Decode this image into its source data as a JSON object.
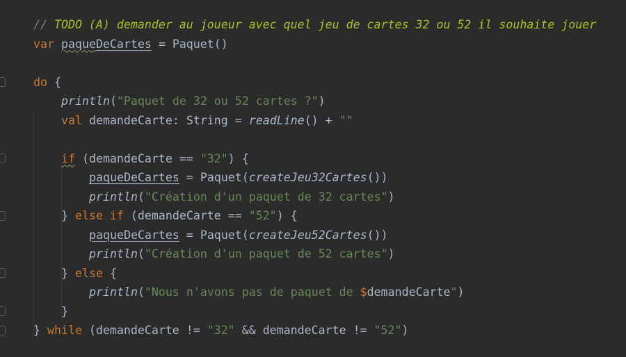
{
  "editor": {
    "lines": [
      {
        "indent": 0,
        "tokens": [
          {
            "t": "// ",
            "c": "cm"
          },
          {
            "t": "TODO (A) demander au joueur avec quel jeu de cartes 32 ou 52 il souhaite jouer",
            "c": "todo"
          }
        ]
      },
      {
        "indent": 0,
        "tokens": [
          {
            "t": "var ",
            "c": "kw"
          },
          {
            "t": "paque",
            "c": "prop warn"
          },
          {
            "t": "DeCartes",
            "c": "prop"
          },
          {
            "t": " = Paquet()",
            "c": ""
          }
        ]
      },
      {
        "indent": 0,
        "tokens": []
      },
      {
        "indent": 0,
        "tokens": [
          {
            "t": "do",
            "c": "kw"
          },
          {
            "t": " {",
            "c": ""
          }
        ]
      },
      {
        "indent": 1,
        "tokens": [
          {
            "t": "println",
            "c": "fn"
          },
          {
            "t": "(",
            "c": ""
          },
          {
            "t": "\"Paquet de 32 ou 52 cartes ?\"",
            "c": "str"
          },
          {
            "t": ")",
            "c": ""
          }
        ]
      },
      {
        "indent": 1,
        "tokens": [
          {
            "t": "val ",
            "c": "kw"
          },
          {
            "t": "demandeCarte: String = ",
            "c": ""
          },
          {
            "t": "readLine",
            "c": "fn"
          },
          {
            "t": "() + ",
            "c": ""
          },
          {
            "t": "\"\"",
            "c": "str"
          }
        ]
      },
      {
        "indent": 0,
        "tokens": []
      },
      {
        "indent": 1,
        "tokens": [
          {
            "t": "if",
            "c": "kw warn"
          },
          {
            "t": " (demandeCarte == ",
            "c": ""
          },
          {
            "t": "\"32\"",
            "c": "str"
          },
          {
            "t": ") {",
            "c": ""
          }
        ]
      },
      {
        "indent": 2,
        "tokens": [
          {
            "t": "paqueDeCartes",
            "c": "prop"
          },
          {
            "t": " = Paquet(",
            "c": ""
          },
          {
            "t": "createJeu32Cartes",
            "c": "fn"
          },
          {
            "t": "())",
            "c": ""
          }
        ]
      },
      {
        "indent": 2,
        "tokens": [
          {
            "t": "println",
            "c": "fn"
          },
          {
            "t": "(",
            "c": ""
          },
          {
            "t": "\"Création d'un paquet de 32 cartes\"",
            "c": "str"
          },
          {
            "t": ")",
            "c": ""
          }
        ]
      },
      {
        "indent": 1,
        "tokens": [
          {
            "t": "} ",
            "c": ""
          },
          {
            "t": "else if",
            "c": "kw"
          },
          {
            "t": " (demandeCarte == ",
            "c": ""
          },
          {
            "t": "\"52\"",
            "c": "str"
          },
          {
            "t": ") {",
            "c": ""
          }
        ]
      },
      {
        "indent": 2,
        "tokens": [
          {
            "t": "paqueDeCartes",
            "c": "prop"
          },
          {
            "t": " = Paquet(",
            "c": ""
          },
          {
            "t": "createJeu52Cartes",
            "c": "fn"
          },
          {
            "t": "())",
            "c": ""
          }
        ]
      },
      {
        "indent": 2,
        "tokens": [
          {
            "t": "println",
            "c": "fn"
          },
          {
            "t": "(",
            "c": ""
          },
          {
            "t": "\"Création d'un paquet de 52 cartes\"",
            "c": "str"
          },
          {
            "t": ")",
            "c": ""
          }
        ]
      },
      {
        "indent": 1,
        "tokens": [
          {
            "t": "} ",
            "c": ""
          },
          {
            "t": "else",
            "c": "kw"
          },
          {
            "t": " {",
            "c": ""
          }
        ]
      },
      {
        "indent": 2,
        "tokens": [
          {
            "t": "println",
            "c": "fn"
          },
          {
            "t": "(",
            "c": ""
          },
          {
            "t": "\"Nous n'avons pas de paquet de ",
            "c": "str"
          },
          {
            "t": "$",
            "c": "kw"
          },
          {
            "t": "demandeCarte",
            "c": ""
          },
          {
            "t": "\"",
            "c": "str"
          },
          {
            "t": ")",
            "c": ""
          }
        ]
      },
      {
        "indent": 1,
        "tokens": [
          {
            "t": "}",
            "c": ""
          }
        ]
      },
      {
        "indent": 0,
        "tokens": [
          {
            "t": "} ",
            "c": ""
          },
          {
            "t": "while",
            "c": "kw"
          },
          {
            "t": " (demandeCarte != ",
            "c": ""
          },
          {
            "t": "\"32\"",
            "c": "str"
          },
          {
            "t": " && demandeCarte != ",
            "c": ""
          },
          {
            "t": "\"52\"",
            "c": "str"
          },
          {
            "t": ")",
            "c": ""
          }
        ]
      }
    ]
  },
  "colors": {
    "background": "#2b2b2b",
    "text": "#a9b7c6",
    "keyword": "#cc7832",
    "string": "#6a8759",
    "todo": "#a8c023"
  }
}
